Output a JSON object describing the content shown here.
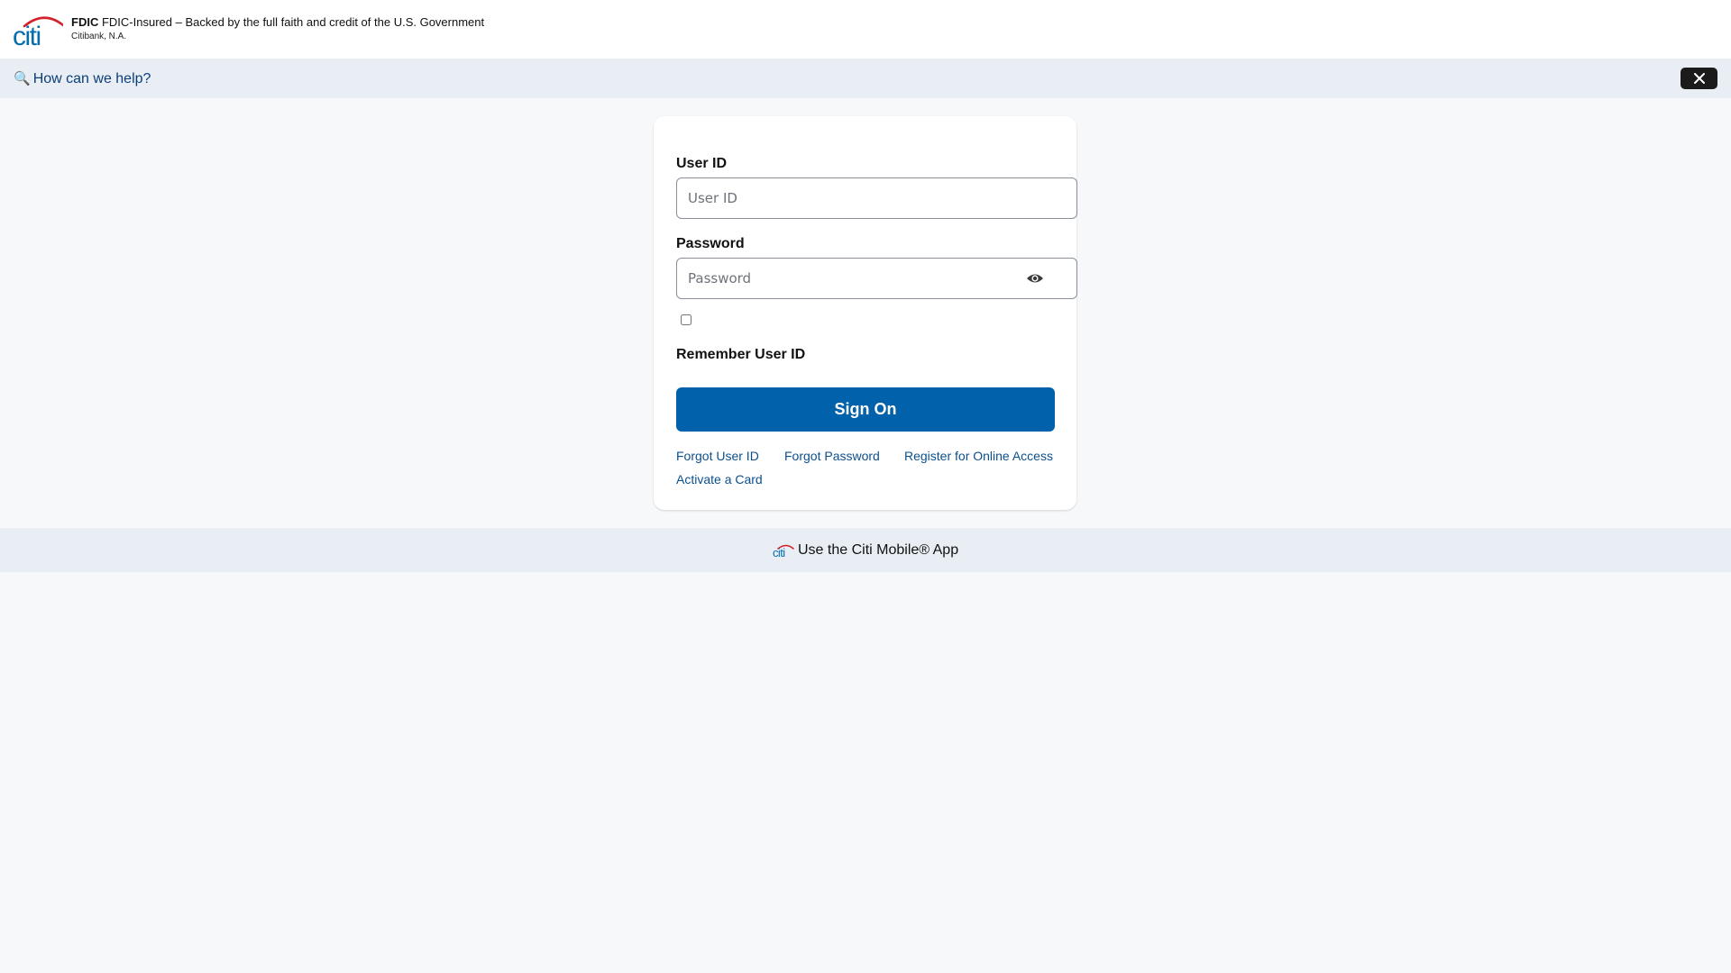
{
  "header": {
    "logo_alt": "citi",
    "fdic_bold": "FDIC",
    "fdic_text": "FDIC-Insured – Backed by the full faith and credit of the U.S. Government",
    "bank_name": "Citibank, N.A."
  },
  "help": {
    "label": "How can we help?",
    "icon": "magnifier-icon",
    "close_icon": "close-icon"
  },
  "login": {
    "user_id_label": "User ID",
    "user_id_placeholder": "User ID",
    "user_id_value": "",
    "password_label": "Password",
    "password_placeholder": "Password",
    "password_value": "",
    "show_password_icon": "eye-icon",
    "remember_checked": false,
    "remember_label": "Remember User ID",
    "sign_on_label": "Sign On",
    "links": {
      "forgot_user_id": "Forgot User ID",
      "forgot_password": "Forgot Password",
      "register": "Register for Online Access",
      "activate_card": "Activate a Card"
    }
  },
  "app_banner": {
    "label": "Use the Citi Mobile® App",
    "icon": "citi-logo-icon"
  },
  "colors": {
    "brand_blue": "#0261ab",
    "logo_red": "#d42029",
    "logo_blue": "#056dae",
    "help_bar_bg": "#e9eef5",
    "page_bg": "#f7f8fa"
  }
}
